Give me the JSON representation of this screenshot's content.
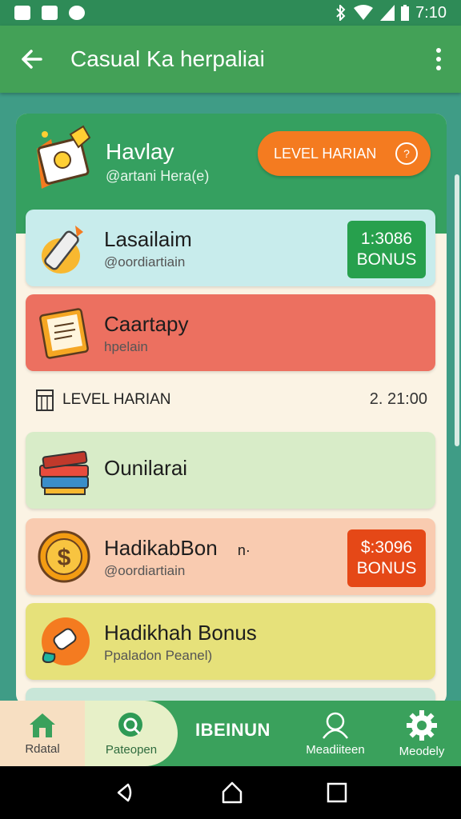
{
  "status_bar": {
    "time": "7:10"
  },
  "app_bar": {
    "title": "Casual Ka herpaliai"
  },
  "header": {
    "title": "Havlay",
    "subtitle": "@artani Hera(e)",
    "level_button": "LEVEL HARIAN"
  },
  "cards_top": [
    {
      "title": "Lasailaim",
      "subtitle": "@oordiartiain",
      "badge_line1": "1:3086",
      "badge_line2": "BONUS",
      "bg": "#c8ecec",
      "badge_color": "#27a04d"
    },
    {
      "title": "Caartapy",
      "subtitle": "hpelain",
      "bg": "#ec7060"
    }
  ],
  "section": {
    "label": "LEVEL HARIAN",
    "time": "2. 21:00"
  },
  "cards_bottom": [
    {
      "title": "Ounilarai",
      "bg": "#d8ecc8"
    },
    {
      "title": "HadikabBon",
      "extra": "n·",
      "subtitle": "@oordiartiain",
      "badge_line1": "$:3096",
      "badge_line2": "BONUS",
      "bg": "#f9cbb0",
      "badge_color": "#e54817"
    },
    {
      "title": "Hadikhah Bonus",
      "subtitle": "Ppaladon Peanel)",
      "bg": "#e6e17a"
    }
  ],
  "bottom_nav": {
    "home_label": "Rdatal",
    "search_label": "Pateopen",
    "center_label": "IBEINUN",
    "profile_label": "Meadiiteen",
    "settings_label": "Meodely"
  },
  "colors": {
    "primary": "#43a157",
    "panel": "#fbf3e4",
    "accent_orange": "#f47b20",
    "badge_green": "#27a04d",
    "badge_red": "#e54817"
  },
  "icons": [
    "back-arrow-icon",
    "more-vert-icon",
    "book-trophy-icon",
    "pen-icon",
    "clipboard-icon",
    "calendar-icon",
    "books-icon",
    "coin-icon",
    "chat-bubble-icon",
    "home-icon",
    "search-icon",
    "person-icon",
    "gear-icon"
  ]
}
